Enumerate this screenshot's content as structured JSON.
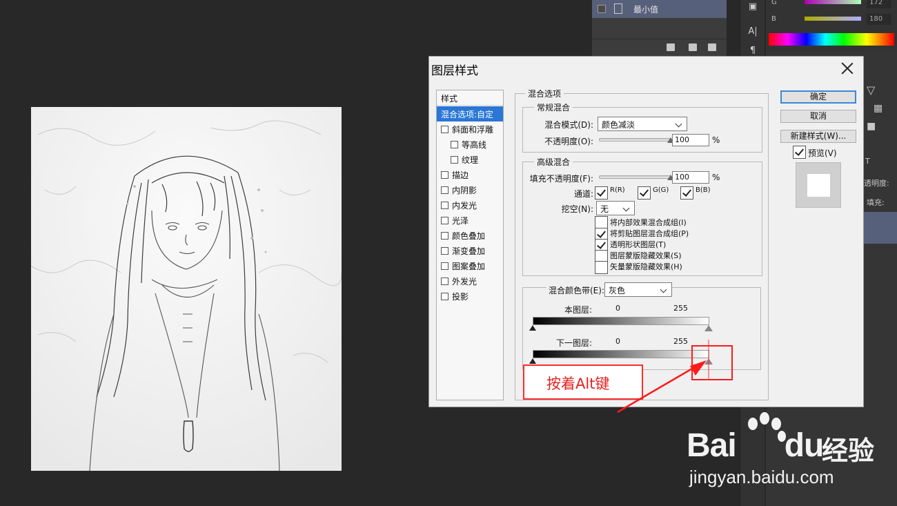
{
  "layers_panel": {
    "layer_name": "最小值"
  },
  "color_panel": {
    "g_label": "G",
    "g_value": "172",
    "b_label": "B",
    "b_value": "180"
  },
  "adjust_panel": {
    "opacity_label": "透明度:",
    "fill_label": "填充:"
  },
  "dialog": {
    "title": "图层样式",
    "styles_header": "样式",
    "styles": [
      {
        "label": "混合选项:自定",
        "selected": true,
        "checkbox": false
      },
      {
        "label": "斜面和浮雕",
        "checkbox": true
      },
      {
        "label": "等高线",
        "checkbox": true,
        "sub": true
      },
      {
        "label": "纹理",
        "checkbox": true,
        "sub": true
      },
      {
        "label": "描边",
        "checkbox": true
      },
      {
        "label": "内阴影",
        "checkbox": true
      },
      {
        "label": "内发光",
        "checkbox": true
      },
      {
        "label": "光泽",
        "checkbox": true
      },
      {
        "label": "颜色叠加",
        "checkbox": true
      },
      {
        "label": "渐变叠加",
        "checkbox": true
      },
      {
        "label": "图案叠加",
        "checkbox": true
      },
      {
        "label": "外发光",
        "checkbox": true
      },
      {
        "label": "投影",
        "checkbox": true
      }
    ],
    "blend_options": {
      "legend": "混合选项",
      "general": {
        "legend": "常规混合",
        "mode_label": "混合模式(D):",
        "mode_value": "颜色减淡",
        "opacity_label": "不透明度(O):",
        "opacity_value": "100",
        "opacity_percent": 100,
        "percent_sign": "%"
      },
      "advanced": {
        "legend": "高级混合",
        "fill_label": "填充不透明度(F):",
        "fill_value": "100",
        "fill_percent": 100,
        "percent_sign": "%",
        "channels_label": "通道:",
        "channel_r": "R(R)",
        "channel_g": "G(G)",
        "channel_b": "B(B)",
        "knockout_label": "挖空(N):",
        "knockout_value": "无",
        "options": [
          {
            "label": "将内部效果混合成组(I)",
            "checked": false
          },
          {
            "label": "将剪贴图层混合成组(P)",
            "checked": true
          },
          {
            "label": "透明形状图层(T)",
            "checked": true
          },
          {
            "label": "图层蒙版隐藏效果(S)",
            "checked": false
          },
          {
            "label": "矢量蒙版隐藏效果(H)",
            "checked": false
          }
        ]
      },
      "blend_if": {
        "label": "混合颜色带(E):",
        "value": "灰色",
        "this_layer_label": "本图层:",
        "this_layer_min": "0",
        "this_layer_max": "255",
        "underlying_label": "下一图层:",
        "underlying_min": "0",
        "underlying_max": "255"
      }
    },
    "buttons": {
      "ok": "确定",
      "cancel": "取消",
      "new_style": "新建样式(W)...",
      "preview": "预览(V)"
    }
  },
  "annotation": {
    "label": "按着Alt键",
    "color": "#ff1a1a"
  },
  "watermark": {
    "brand": "Bai",
    "brand_tail": "du",
    "cn": "经验",
    "url": "jingyan.baidu.com"
  }
}
